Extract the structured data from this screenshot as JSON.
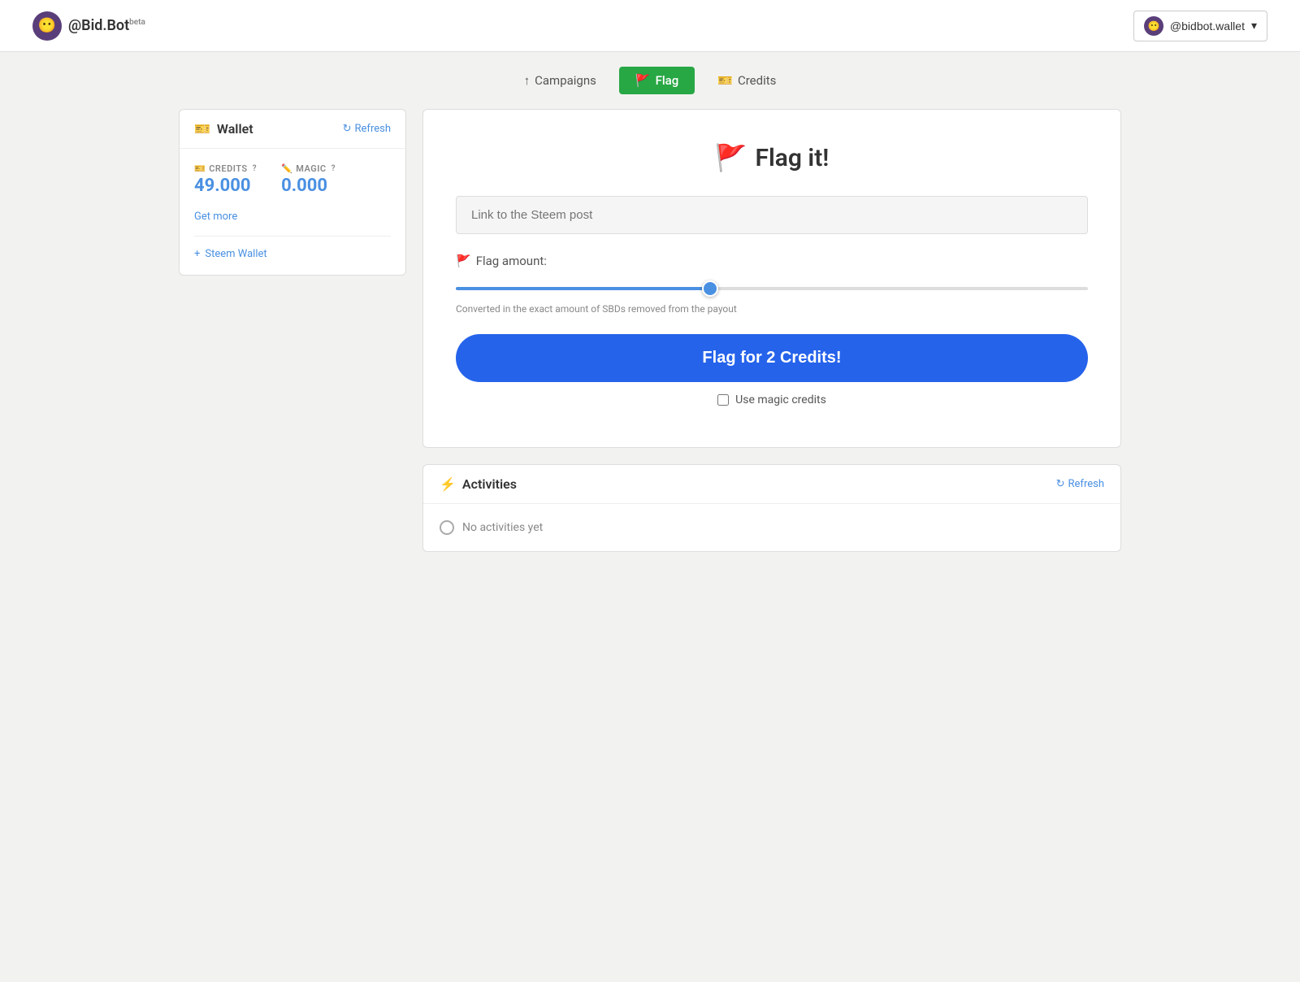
{
  "app": {
    "logo_emoji": "😶",
    "logo_text": "@Bid.Bot",
    "logo_beta": "beta"
  },
  "header": {
    "wallet_user": "@bidbot.wallet",
    "wallet_avatar_emoji": "😶",
    "dropdown_arrow": "▾"
  },
  "nav": {
    "items": [
      {
        "id": "campaigns",
        "label": "Campaigns",
        "icon": "↑",
        "active": false
      },
      {
        "id": "flag",
        "label": "Flag",
        "icon": "🚩",
        "active": true
      },
      {
        "id": "credits",
        "label": "Credits",
        "icon": "🎫",
        "active": false
      }
    ]
  },
  "sidebar": {
    "wallet_title": "Wallet",
    "wallet_icon": "🎫",
    "refresh_label": "Refresh",
    "credits_label": "CREDITS",
    "credits_help": "?",
    "credits_value": "49.000",
    "magic_label": "MAGIC",
    "magic_help": "?",
    "magic_icon": "✏️",
    "magic_value": "0.000",
    "get_more_label": "Get more",
    "steem_wallet_label": "Steem Wallet",
    "steem_wallet_icon": "+"
  },
  "flag_form": {
    "title": "Flag it!",
    "title_emoji": "🚩",
    "post_placeholder": "Link to the Steem post",
    "amount_label": "Flag amount:",
    "amount_icon": "🚩",
    "slider_min": 0,
    "slider_max": 100,
    "slider_value": 40,
    "slider_note": "Converted in the exact amount of SBDs removed from the payout",
    "flag_button_label": "Flag for 2 Credits!",
    "magic_credits_label": "Use magic credits",
    "magic_credits_checked": false
  },
  "activities": {
    "title": "Activities",
    "title_icon": "⚡",
    "refresh_label": "Refresh",
    "empty_label": "No activities yet"
  }
}
